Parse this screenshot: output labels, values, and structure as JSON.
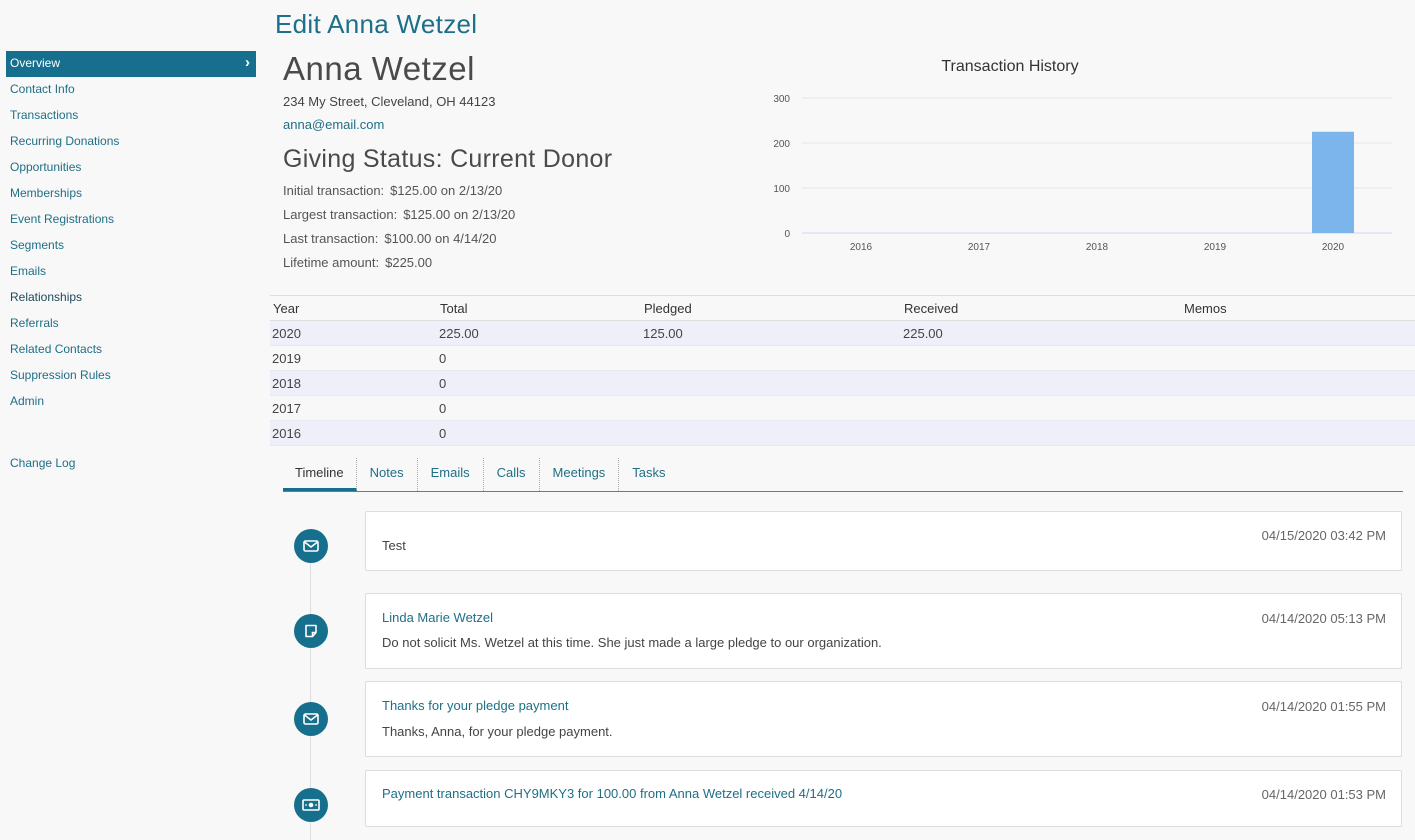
{
  "page_title": "Edit Anna Wetzel",
  "sidebar": {
    "items": [
      {
        "label": "Overview"
      },
      {
        "label": "Contact Info"
      },
      {
        "label": "Transactions"
      },
      {
        "label": "Recurring Donations"
      },
      {
        "label": "Opportunities"
      },
      {
        "label": "Memberships"
      },
      {
        "label": "Event Registrations"
      },
      {
        "label": "Segments"
      },
      {
        "label": "Emails"
      },
      {
        "label": "Relationships"
      },
      {
        "label": "Referrals"
      },
      {
        "label": "Related Contacts"
      },
      {
        "label": "Suppression Rules"
      },
      {
        "label": "Admin"
      }
    ],
    "change_log": "Change Log",
    "active_chevron": "›"
  },
  "profile": {
    "name": "Anna Wetzel",
    "address": "234 My Street, Cleveland, OH 44123",
    "email": "anna@email.com",
    "giving_status": "Giving Status: Current Donor",
    "stats": [
      {
        "label": "Initial transaction:",
        "value": "$125.00 on 2/13/20"
      },
      {
        "label": "Largest transaction:",
        "value": "$125.00 on 2/13/20"
      },
      {
        "label": "Last transaction:",
        "value": "$100.00 on 4/14/20"
      },
      {
        "label": "Lifetime amount:",
        "value": "$225.00"
      }
    ]
  },
  "chart_data": {
    "type": "bar",
    "title": "Transaction History",
    "categories": [
      "2016",
      "2017",
      "2018",
      "2019",
      "2020"
    ],
    "values": [
      0,
      0,
      0,
      0,
      225
    ],
    "yticks": [
      0,
      100,
      200,
      300
    ],
    "ylim": [
      0,
      300
    ],
    "grid": true,
    "bar_color": "#7cb5ec"
  },
  "year_table": {
    "headers": [
      "Year",
      "Total",
      "Pledged",
      "Received",
      "Memos"
    ],
    "rows": [
      [
        "2020",
        "225.00",
        "125.00",
        "225.00",
        ""
      ],
      [
        "2019",
        "0",
        "",
        "",
        ""
      ],
      [
        "2018",
        "0",
        "",
        "",
        ""
      ],
      [
        "2017",
        "0",
        "",
        "",
        ""
      ],
      [
        "2016",
        "0",
        "",
        "",
        ""
      ]
    ]
  },
  "tabs": [
    "Timeline",
    "Notes",
    "Emails",
    "Calls",
    "Meetings",
    "Tasks"
  ],
  "timeline": [
    {
      "icon": "envelope-icon",
      "title": "",
      "body": "Test",
      "time": "04/15/2020 03:42 PM"
    },
    {
      "icon": "note-icon",
      "title": "Linda Marie Wetzel",
      "body": "Do not solicit Ms. Wetzel at this time. She just made a large pledge to our organization.",
      "time": "04/14/2020 05:13 PM"
    },
    {
      "icon": "envelope-icon",
      "title": "Thanks for your pledge payment",
      "body": "Thanks, Anna, for your pledge payment.",
      "time": "04/14/2020 01:55 PM"
    },
    {
      "icon": "money-icon",
      "title": "Payment transaction CHY9MKY3 for 100.00 from Anna Wetzel received 4/14/20",
      "body": "",
      "time": "04/14/2020 01:53 PM"
    }
  ],
  "colors": {
    "accent": "#166f8d",
    "link": "#1f6f86",
    "row_alt": "#efeffa"
  }
}
